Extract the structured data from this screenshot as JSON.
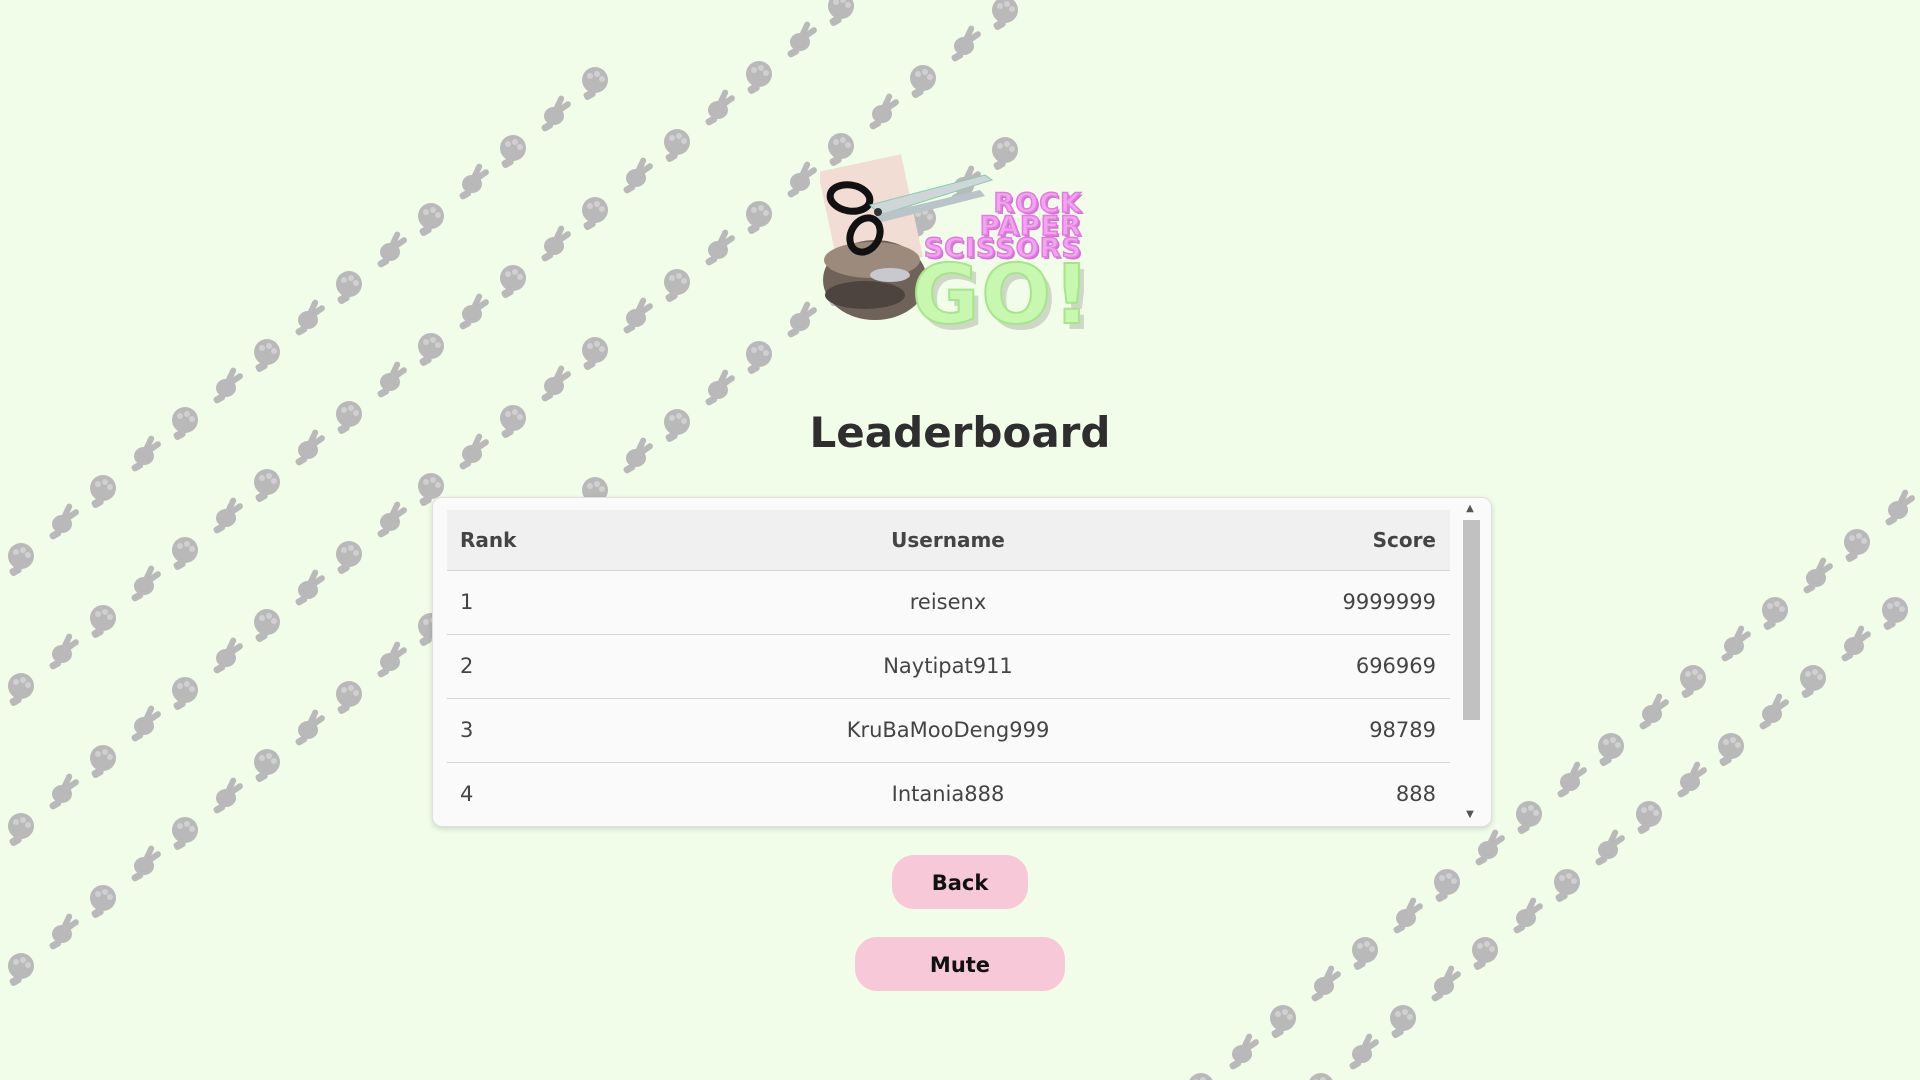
{
  "logo": {
    "words": [
      "ROCK",
      "PAPER",
      "SCISSORS"
    ],
    "go": "GO!"
  },
  "page_title": "Leaderboard",
  "leaderboard": {
    "headers": {
      "rank": "Rank",
      "username": "Username",
      "score": "Score"
    },
    "rows": [
      {
        "rank": "1",
        "username": "reisenx",
        "score": "9999999"
      },
      {
        "rank": "2",
        "username": "Naytipat911",
        "score": "696969"
      },
      {
        "rank": "3",
        "username": "KruBaMooDeng999",
        "score": "98789"
      },
      {
        "rank": "4",
        "username": "Intania888",
        "score": "888"
      }
    ]
  },
  "buttons": {
    "back": "Back",
    "mute": "Mute"
  },
  "colors": {
    "background": "#f2fde9",
    "button": "#f7c8d8",
    "pattern_hand": "#b9b9b9"
  },
  "icons": [
    "rock-hand-icon",
    "scissors-hand-icon",
    "scroll-up-arrow-icon",
    "scroll-down-arrow-icon"
  ]
}
